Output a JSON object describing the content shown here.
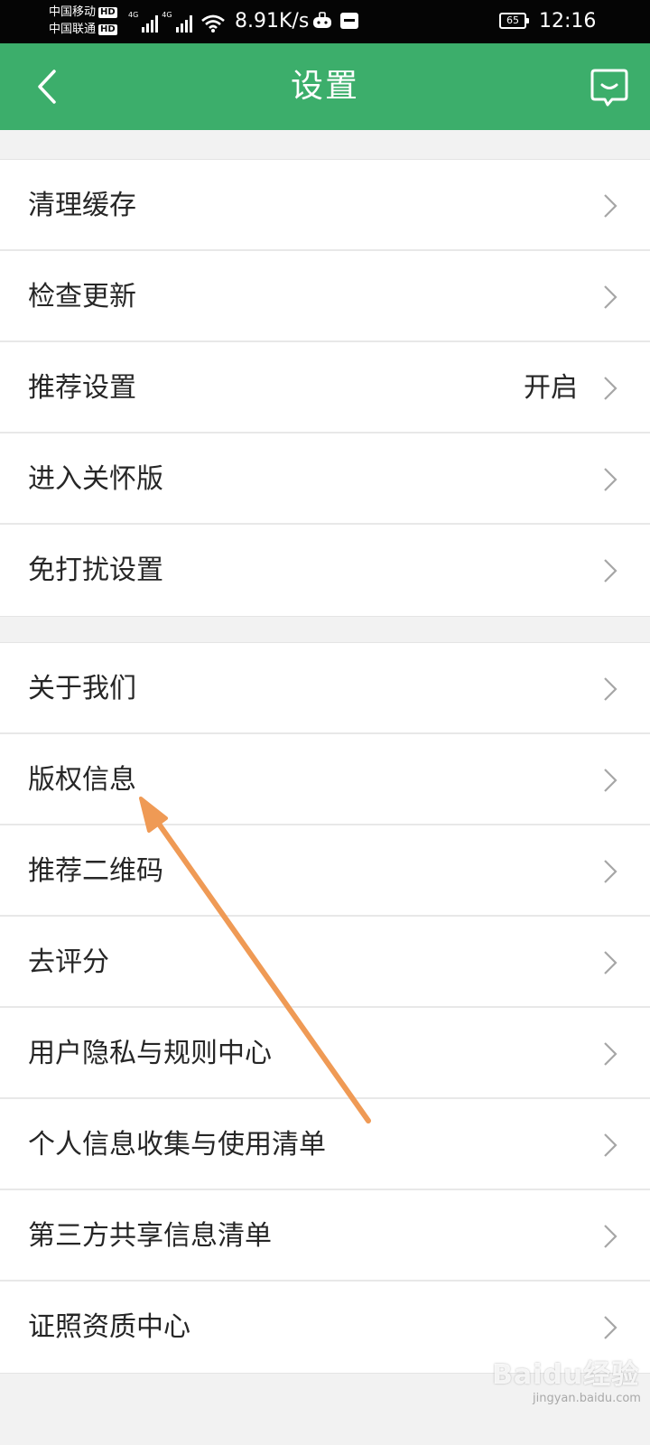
{
  "status_bar": {
    "carrier_1": "中国移动",
    "carrier_2": "中国联通",
    "hd_badge": "HD",
    "net_type": "4G",
    "net_speed": "8.91K/s",
    "battery_level": "65",
    "time": "12:16"
  },
  "header": {
    "title": "设置",
    "back_icon": "chevron-left-icon",
    "feedback_icon": "chat-bubble-smile-icon",
    "background_color": "#3cae6b"
  },
  "groups": [
    {
      "items": [
        {
          "label": "清理缓存",
          "value": ""
        },
        {
          "label": "检查更新",
          "value": ""
        },
        {
          "label": "推荐设置",
          "value": "开启"
        },
        {
          "label": "进入关怀版",
          "value": ""
        },
        {
          "label": "免打扰设置",
          "value": ""
        }
      ]
    },
    {
      "items": [
        {
          "label": "关于我们",
          "value": ""
        },
        {
          "label": "版权信息",
          "value": ""
        },
        {
          "label": "推荐二维码",
          "value": ""
        },
        {
          "label": "去评分",
          "value": ""
        },
        {
          "label": "用户隐私与规则中心",
          "value": ""
        },
        {
          "label": "个人信息收集与使用清单",
          "value": ""
        },
        {
          "label": "第三方共享信息清单",
          "value": ""
        },
        {
          "label": "证照资质中心",
          "value": ""
        }
      ]
    }
  ],
  "annotation": {
    "arrow_color": "#ef9a55",
    "target": "版权信息"
  },
  "watermark": {
    "text": "Baidu经验",
    "sub": "jingyan.baidu.com"
  }
}
